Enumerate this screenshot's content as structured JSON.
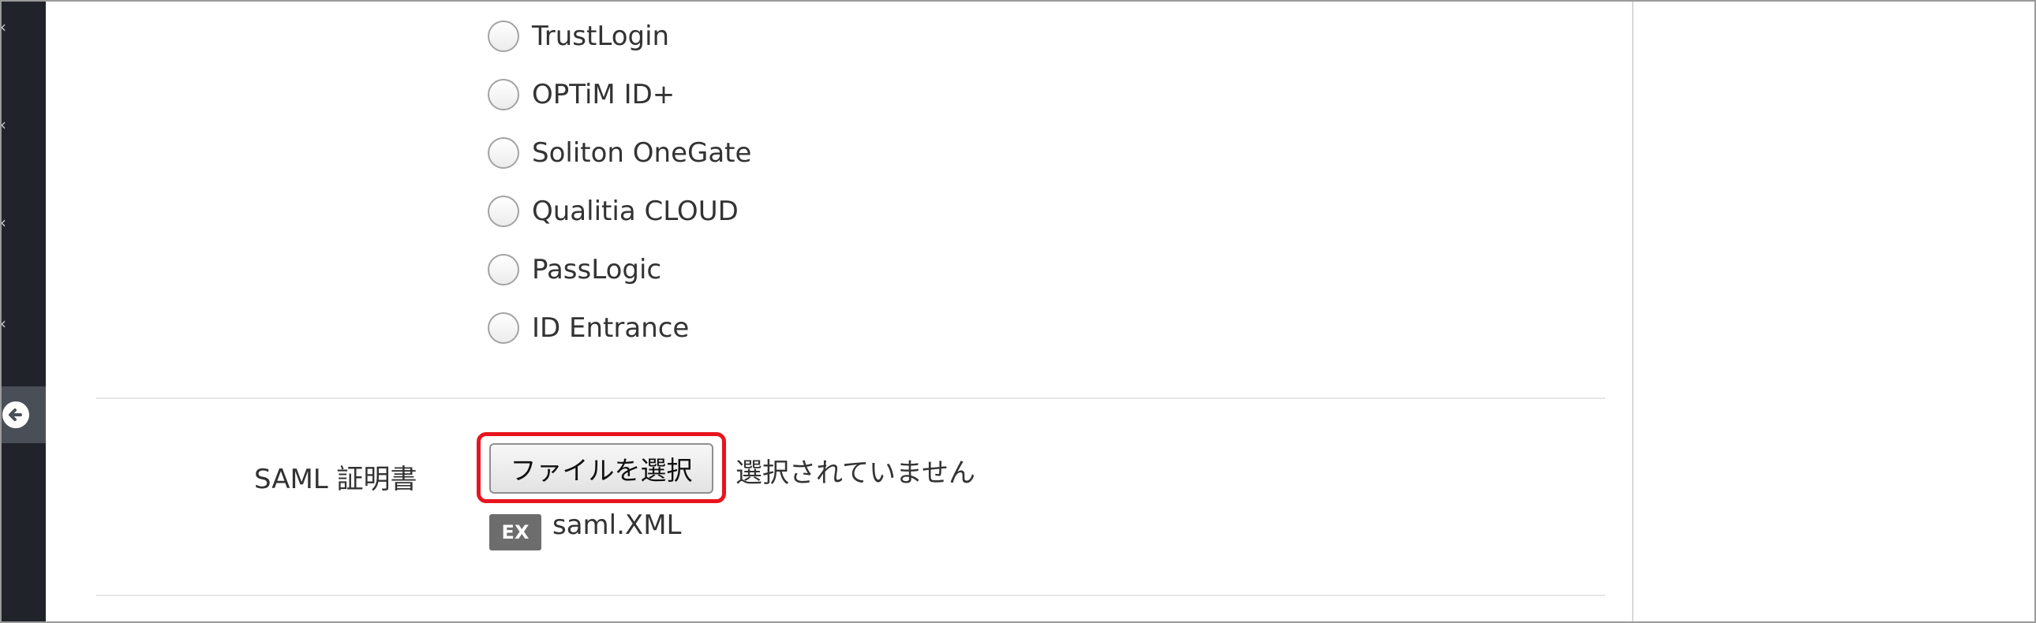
{
  "auth_providers": {
    "options": [
      {
        "label": "TrustLogin"
      },
      {
        "label": "OPTiM ID+"
      },
      {
        "label": "Soliton OneGate"
      },
      {
        "label": "Qualitia CLOUD"
      },
      {
        "label": "PassLogic"
      },
      {
        "label": "ID Entrance"
      }
    ]
  },
  "saml_certificate": {
    "label": "SAML 証明書",
    "choose_file_button": "ファイルを選択",
    "file_status": "選択されていません",
    "example_badge": "EX",
    "example_filename": "saml.XML"
  },
  "colors": {
    "sidebar_bg": "#20232a",
    "highlight_border": "#e8141d",
    "badge_bg": "#6d6d6d"
  },
  "icons": {
    "sidebar_chevrons": "chevron-left-icon",
    "back": "arrow-circle-left-icon"
  }
}
